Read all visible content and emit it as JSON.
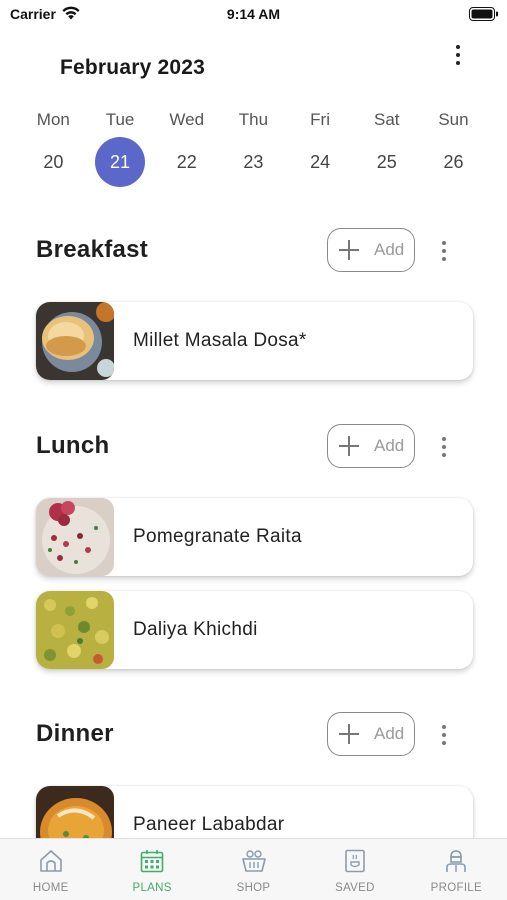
{
  "status_bar": {
    "carrier": "Carrier",
    "time": "9:14 AM"
  },
  "header": {
    "month": "February 2023"
  },
  "week": {
    "days": [
      {
        "name": "Mon",
        "num": "20"
      },
      {
        "name": "Tue",
        "num": "21"
      },
      {
        "name": "Wed",
        "num": "22"
      },
      {
        "name": "Thu",
        "num": "23"
      },
      {
        "name": "Fri",
        "num": "24"
      },
      {
        "name": "Sat",
        "num": "25"
      },
      {
        "name": "Sun",
        "num": "26"
      }
    ],
    "selected_day": "21"
  },
  "meals": {
    "breakfast": {
      "title": "Breakfast",
      "add_label": "Add",
      "recipes": [
        "Millet Masala Dosa*"
      ]
    },
    "lunch": {
      "title": "Lunch",
      "add_label": "Add",
      "recipes": [
        "Pomegranate Raita",
        "Daliya Khichdi"
      ]
    },
    "dinner": {
      "title": "Dinner",
      "add_label": "Add",
      "recipes": [
        "Paneer Lababdar"
      ]
    }
  },
  "tabs": [
    {
      "label": "HOME",
      "icon": "home-icon"
    },
    {
      "label": "PLANS",
      "icon": "calendar-icon"
    },
    {
      "label": "SHOP",
      "icon": "basket-icon"
    },
    {
      "label": "SAVED",
      "icon": "cookbook-icon"
    },
    {
      "label": "PROFILE",
      "icon": "chef-icon"
    }
  ],
  "active_tab": "PLANS",
  "colors": {
    "accent": "#5b67c9",
    "active_tab": "#3fae6a",
    "inactive_tab": "#8a8a8a"
  }
}
